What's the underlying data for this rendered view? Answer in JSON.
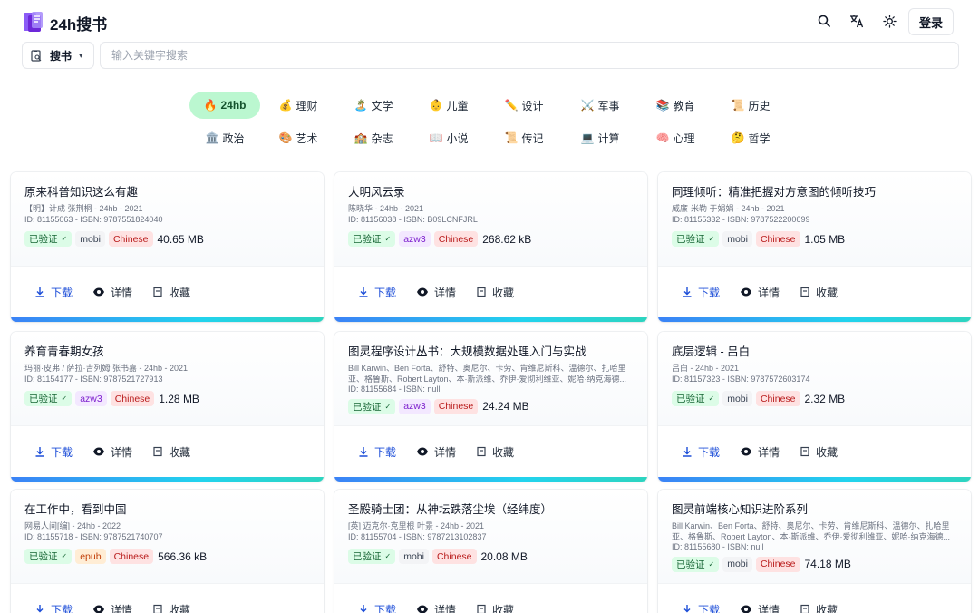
{
  "header": {
    "brand": "24h搜书",
    "login_label": "登录",
    "icons": [
      "search-icon",
      "translate-icon",
      "theme-sun-icon"
    ]
  },
  "search": {
    "type_label": "搜书",
    "placeholder": "输入关键字搜索",
    "value": ""
  },
  "categories": [
    {
      "emoji": "🔥",
      "label": "24hb",
      "active": true
    },
    {
      "emoji": "💰",
      "label": "理财"
    },
    {
      "emoji": "🏝️",
      "label": "文学"
    },
    {
      "emoji": "👶",
      "label": "儿童"
    },
    {
      "emoji": "✏️",
      "label": "设计"
    },
    {
      "emoji": "⚔️",
      "label": "军事"
    },
    {
      "emoji": "📚",
      "label": "教育"
    },
    {
      "emoji": "📜",
      "label": "历史"
    },
    {
      "emoji": "🏛️",
      "label": "政治"
    },
    {
      "emoji": "🎨",
      "label": "艺术"
    },
    {
      "emoji": "🏫",
      "label": "杂志"
    },
    {
      "emoji": "📖",
      "label": "小说"
    },
    {
      "emoji": "📜",
      "label": "传记"
    },
    {
      "emoji": "💻",
      "label": "计算"
    },
    {
      "emoji": "🧠",
      "label": "心理"
    },
    {
      "emoji": "🤔",
      "label": "哲学"
    }
  ],
  "actions": {
    "download": "下载",
    "details": "详情",
    "favorite": "收藏"
  },
  "verified_label": "已验证",
  "books": [
    {
      "title": "原来科普知识这么有趣",
      "meta": "【明】计成 张荆桐 - 24hb - 2021",
      "meta2": "ID: 81155063 - ISBN: 9787551824040",
      "format": "mobi",
      "lang": "Chinese",
      "size": "40.65 MB"
    },
    {
      "title": "大明风云录",
      "meta": "陈晓华 - 24hb - 2021",
      "meta2": "ID: 81156038 - ISBN: B09LCNFJRL",
      "format": "azw3",
      "lang": "Chinese",
      "size": "268.62 kB"
    },
    {
      "title": "同理倾听：精准把握对方意图的倾听技巧",
      "meta": "威廉·米勒 于娟娟 - 24hb - 2021",
      "meta2": "ID: 81155332 - ISBN: 9787522200699",
      "format": "mobi",
      "lang": "Chinese",
      "size": "1.05 MB"
    },
    {
      "title": "养育青春期女孩",
      "meta": "玛丽·皮弗 / 萨拉·吉列姆 张书嘉 - 24hb - 2021",
      "meta2": "ID: 81154177 - ISBN: 9787521727913",
      "format": "azw3",
      "lang": "Chinese",
      "size": "1.28 MB"
    },
    {
      "title": "图灵程序设计丛书：大规模数据处理入门与实战",
      "meta": "Bill Karwin、Ben Forta、舒特、奥尼尔、卡劳、肯维尼斯科、温德尔、扎哈里亚、格鲁斯、Robert Layton、本·斯派维、乔伊·爱彻利维亚、妮哈·纳克海德...",
      "meta2": "ID: 81155684 - ISBN: null",
      "format": "azw3",
      "lang": "Chinese",
      "size": "24.24 MB"
    },
    {
      "title": "底层逻辑 - 吕白",
      "meta": "吕白 - 24hb - 2021",
      "meta2": "ID: 81157323 - ISBN: 9787572603174",
      "format": "mobi",
      "lang": "Chinese",
      "size": "2.32 MB"
    },
    {
      "title": "在工作中，看到中国",
      "meta": "网易人间[编] - 24hb - 2022",
      "meta2": "ID: 81155718 - ISBN: 9787521740707",
      "format": "epub",
      "lang": "Chinese",
      "size": "566.36 kB"
    },
    {
      "title": "圣殿骑士团：从神坛跌落尘埃（经纬度）",
      "meta": "[英] 迈克尔·克里根 叶景 - 24hb - 2021",
      "meta2": "ID: 81155704 - ISBN: 9787213102837",
      "format": "mobi",
      "lang": "Chinese",
      "size": "20.08 MB"
    },
    {
      "title": "图灵前端核心知识进阶系列",
      "meta": "Bill Karwin、Ben Forta、舒特、奥尼尔、卡劳、肯维尼斯科、温德尔、扎哈里亚、格鲁斯、Robert Layton、本·斯派维、乔伊·爱彻利维亚、妮哈·纳克海德...",
      "meta2": "ID: 81155680 - ISBN: null",
      "format": "mobi",
      "lang": "Chinese",
      "size": "74.18 MB"
    }
  ]
}
